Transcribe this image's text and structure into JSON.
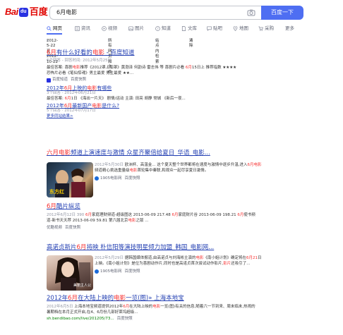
{
  "header": {
    "logo_bai": "Bai",
    "logo_paw": "du",
    "logo_du": "百度",
    "query": "6月电影",
    "search_button": "百度一下"
  },
  "tabs": [
    {
      "label": "网页",
      "icon": "search-icon"
    },
    {
      "label": "资讯",
      "icon": "news-icon"
    },
    {
      "label": "视频",
      "icon": "video-icon"
    },
    {
      "label": "图片",
      "icon": "image-icon"
    },
    {
      "label": "知道",
      "icon": "question-icon"
    },
    {
      "label": "文库",
      "icon": "doc-icon"
    },
    {
      "label": "贴吧",
      "icon": "chat-icon"
    },
    {
      "label": "地图",
      "icon": "map-icon"
    },
    {
      "label": "采购",
      "icon": "cart-icon"
    },
    {
      "label": "更多",
      "icon": ""
    }
  ],
  "filters": {
    "time_range": "2012-5-22至2012-10-22",
    "file_type": "所有网页和文件",
    "site": "站点内检索",
    "clear": "清除"
  },
  "results": {
    "r1": {
      "title_pre": "6月",
      "title_mid": "有什么好看的",
      "title_hl": "电影",
      "title_post": " - 百度知道",
      "meta": "6个回答 - 回答时间: 2012年5月25日",
      "snippet_a": "最佳答案: 喜剧",
      "snippet_a_hl": "电影",
      "snippet_b": "推荐《2012罩上加罩》黄渤泽 何韵诗 雷志伟 等 喜剧片必看 ",
      "snippet_b_hl": "6月",
      "snippet_c": "15日上 推荐指数 ★★★★ 恐怖片必看《笔仙惊魂》男主最爱 男主最爱 ★★...",
      "source_name": "百度知道",
      "source_snap": "百度快照",
      "sub1_pre": "2012年",
      "sub1_hl": "6月",
      "sub1_mid": "上映的",
      "sub1_hl2": "电影",
      "sub1_post": "有哪些",
      "sub1_meta": "3个回答 · 2012年06月21日",
      "sub1_snippet_a": "最佳答案: ",
      "sub1_snippet_hl": "6月",
      "sub1_snippet_b": "1日 《海出一片天》 剧情/运动 主演: 田亮 胡静 常城 《新后一夜...",
      "sub2_pre": "2012年",
      "sub2_hl": "6月",
      "sub2_mid": "最新国产",
      "sub2_hl2": "电影",
      "sub2_post": "是什么?",
      "sub2_meta": "5个回答 · 2012年07月17日",
      "more": "更多同站结果>"
    },
    "r2": {
      "title_pre": "六月",
      "title_hl": "电影",
      "title_post": "频道上演速度与激情 众星齐聚倍给夏日_华语_电影...",
      "snippet_date": "2012年5月30日",
      "snippet_a": " 欧洲杯、高温金... 这个夏天整个世界都将在速度与激情中逐步升温,进入",
      "snippet_hl": "6月",
      "snippet_hl2": "电影",
      "snippet_b": "频道精心挑选重量级",
      "snippet_hl3": "电影",
      "snippet_c": "首轮集中秦联,和观众一起尽享夏日激情。",
      "source_name": "1905电影网",
      "source_snap": "百度快照",
      "thumb_caption": "东方红"
    },
    "r3": {
      "title_pre": "6月",
      "title_post": "酷片纵览",
      "snippet_a": "2012年6月12日 390 ",
      "snippet_hl": "6月",
      "snippet_b": "家庭理财频道-超级图这 2013-06-09 217.48 ",
      "snippet_hl2": "6月",
      "snippet_c": "家庭财片谷 2013-06-09 198.21 ",
      "snippet_hl3": "6月",
      "snippet_d": "使书频道-新书天天荐 2013-06-09 59.81 第六届北京",
      "snippet_hl4": "电影",
      "snippet_e": "之版 ...",
      "source_name": "优酷视频",
      "source_snap": "百度快照"
    },
    "r4": {
      "title_pre": "高诺贞新片",
      "title_hl": "6月",
      "title_post": "将映 朴信阳等演技明星倾力加盟_韩国_电影网...",
      "snippet_date": "2012年5月29日",
      "snippet_a": " 据韩国媒体报道,由高诺贞与刘海彬主演的",
      "snippet_hl": "电影",
      "snippet_b": "《南小姐计划》确定将在",
      "snippet_hl2": "6月21",
      "snippet_c": "日上映。《南小姐计划》是位为喜剧动作片,同时也是高诺贞首次尝试动作影片,",
      "snippet_hl3": "影片",
      "snippet_d": "还吸引了...",
      "source_name": "1905电影网",
      "source_snap": "百度快照",
      "thumb_caption": "美丽主人公"
    },
    "r5": {
      "title_pre": "2012年",
      "title_hl": "6月",
      "title_mid": "在大陆上映的",
      "title_hl2": "电影",
      "title_post": "一览(图)» 上海本地宝",
      "snippet_date": "2012年6月5日",
      "snippet_a": " 上海本地宝频道提供2012年",
      "snippet_hl": "6月",
      "snippet_b": "在大陆上映的",
      "snippet_hl2": "电影",
      "snippet_c": "一览(图)有关的信息,随着六一节到来、周末临末,热闹的暑期档在本月正式开启,在4、6月份几部好莱坞超级...",
      "source_url": "sh.bendibao.com/live/201205/73...",
      "source_snap": "百度快照"
    }
  }
}
